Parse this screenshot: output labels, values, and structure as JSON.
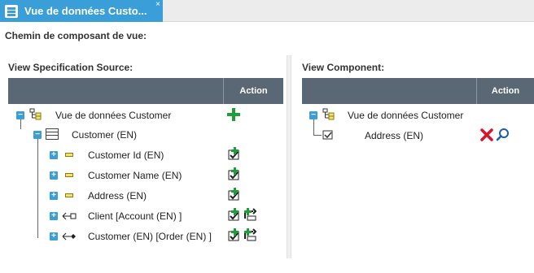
{
  "tab": {
    "title": "Vue de données Custo...",
    "close": "×"
  },
  "page": {
    "section_title": "Chemin de composant de vue:"
  },
  "left": {
    "label": "View Specification Source:",
    "action_header": "Action",
    "rows": [
      {
        "text": "Vue de données Customer",
        "expander": "−"
      },
      {
        "text": "Customer (EN)",
        "expander": "−"
      },
      {
        "text": "Customer Id (EN)",
        "expander": "+"
      },
      {
        "text": "Customer Name (EN)",
        "expander": "+"
      },
      {
        "text": "Address (EN)",
        "expander": "+"
      },
      {
        "text": "Client [Account (EN) ]",
        "expander": "+"
      },
      {
        "text": "Customer (EN)  [Order (EN) ]",
        "expander": "+"
      }
    ]
  },
  "right": {
    "label": "View Component:",
    "action_header": "Action",
    "rows": [
      {
        "text": "Vue de données Customer",
        "expander": "−"
      },
      {
        "text": "Address (EN)"
      }
    ]
  },
  "colors": {
    "accent": "#3a9fd9",
    "header": "#5a6774",
    "add": "#1f9d3a",
    "delete": "#d9142a",
    "search": "#1f5fa8"
  },
  "icons": {
    "tab": "list-icon",
    "add": "plus-icon",
    "add_check": "check-add-icon",
    "add_link": "link-add-icon",
    "delete": "delete-icon",
    "search": "magnifier-icon"
  }
}
